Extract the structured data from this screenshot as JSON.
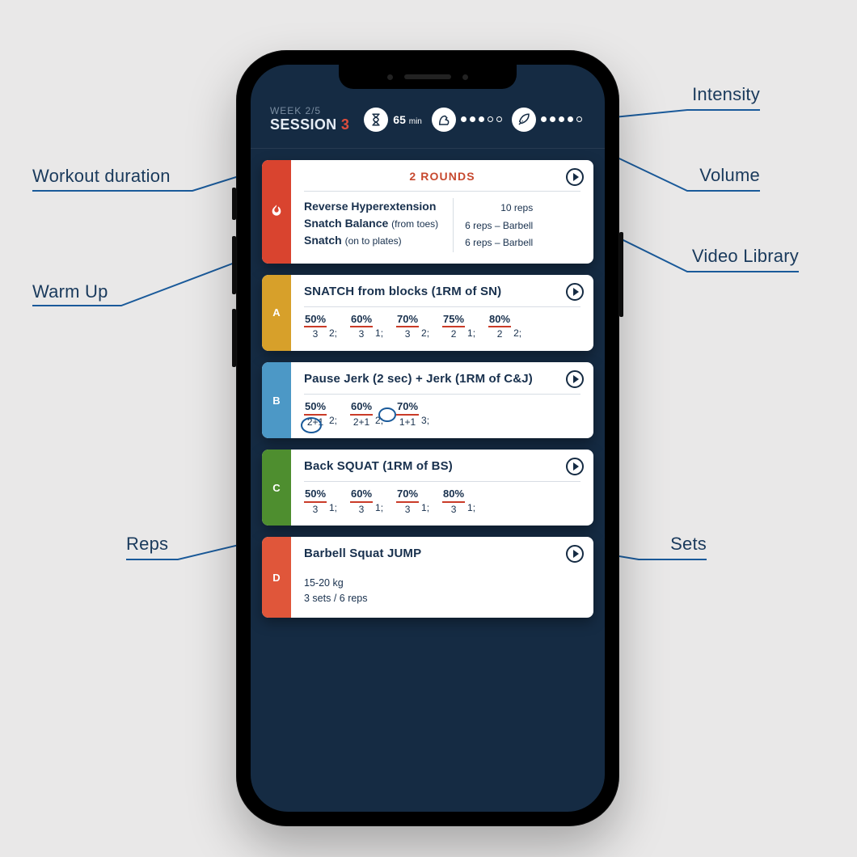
{
  "header": {
    "week_label": "WEEK 2/5",
    "session_label": "SESSION ",
    "session_number": "3",
    "duration_value": "65",
    "duration_unit": "min",
    "intensity_filled": 3,
    "intensity_total": 5,
    "volume_filled": 4,
    "volume_total": 5
  },
  "warmup": {
    "rounds_label": "2 ROUNDS",
    "ex": [
      {
        "name": "Reverse Hyperextension",
        "sub": "",
        "desc": "10 reps"
      },
      {
        "name": "Snatch Balance",
        "sub": "(from toes)",
        "desc": "6 reps – Barbell"
      },
      {
        "name": "Snatch",
        "sub": "(on to plates)",
        "desc": "6 reps – Barbell"
      }
    ]
  },
  "blocks": {
    "a": {
      "tag": "A",
      "title": "SNATCH from blocks (1RM of SN)",
      "sets": [
        {
          "pct": "50%",
          "reps": "3",
          "count": "2;"
        },
        {
          "pct": "60%",
          "reps": "3",
          "count": "1;"
        },
        {
          "pct": "70%",
          "reps": "3",
          "count": "2;"
        },
        {
          "pct": "75%",
          "reps": "2",
          "count": "1;"
        },
        {
          "pct": "80%",
          "reps": "2",
          "count": "2;"
        }
      ]
    },
    "b": {
      "tag": "B",
      "title": "Pause Jerk (2 sec) + Jerk (1RM of C&J)",
      "sets": [
        {
          "pct": "50%",
          "reps": "2+1",
          "count": "2;"
        },
        {
          "pct": "60%",
          "reps": "2+1",
          "count": "2;"
        },
        {
          "pct": "70%",
          "reps": "1+1",
          "count": "3;"
        }
      ]
    },
    "c": {
      "tag": "C",
      "title": "Back SQUAT (1RM of BS)",
      "sets": [
        {
          "pct": "50%",
          "reps": "3",
          "count": "1;"
        },
        {
          "pct": "60%",
          "reps": "3",
          "count": "1;"
        },
        {
          "pct": "70%",
          "reps": "3",
          "count": "1;"
        },
        {
          "pct": "80%",
          "reps": "3",
          "count": "1;"
        }
      ]
    },
    "d": {
      "tag": "D",
      "title": "Barbell Squat JUMP",
      "line1": "15-20 kg",
      "line2": "3 sets / 6 reps"
    }
  },
  "annotations": {
    "duration": "Workout duration",
    "warmup": "Warm Up",
    "reps": "Reps",
    "intensity": "Intensity",
    "volume": "Volume",
    "video": "Video Library",
    "sets": "Sets"
  }
}
